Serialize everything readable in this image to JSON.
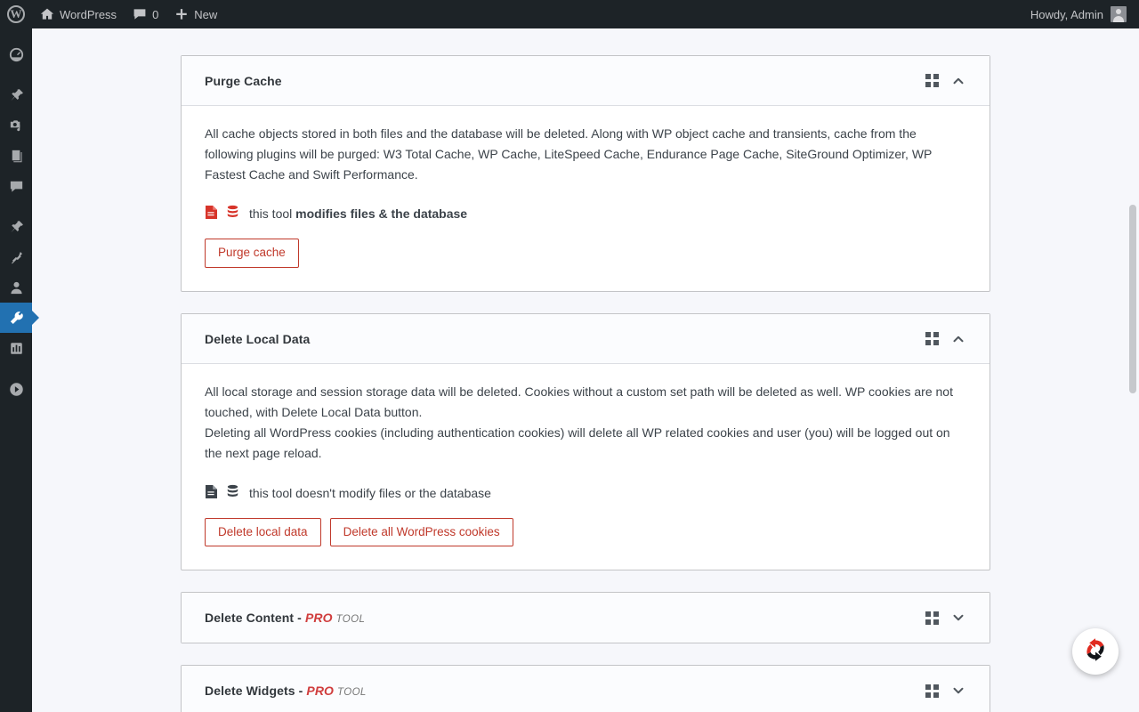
{
  "adminbar": {
    "logo_icon": "wordpress-logo-icon",
    "site_name": "WordPress",
    "site_icon": "home-icon",
    "comments_icon": "comment-bubble-icon",
    "comments_count": "0",
    "new_icon": "plus-icon",
    "new_label": "New",
    "howdy": "Howdy, Admin",
    "avatar_icon": "user-avatar-icon"
  },
  "sidebar": {
    "items": [
      {
        "name": "dashboard",
        "icon": "dashboard-gauge-icon",
        "current": false
      },
      {
        "name": "posts",
        "icon": "pushpin-icon",
        "current": false
      },
      {
        "name": "media",
        "icon": "media-camera-music-icon",
        "current": false
      },
      {
        "name": "pages",
        "icon": "page-document-icon",
        "current": false
      },
      {
        "name": "comments",
        "icon": "comment-bubble-icon",
        "current": false
      },
      {
        "name": "appearance",
        "icon": "paintbrush-icon",
        "current": false
      },
      {
        "name": "plugins",
        "icon": "plug-icon",
        "current": false
      },
      {
        "name": "users",
        "icon": "user-icon",
        "current": false
      },
      {
        "name": "tools",
        "icon": "wrench-icon",
        "current": true
      },
      {
        "name": "settings",
        "icon": "settings-sliders-icon",
        "current": false
      },
      {
        "name": "collapse-menu",
        "icon": "collapse-arrow-icon",
        "current": false
      }
    ]
  },
  "colors": {
    "danger": "#c0392b",
    "pro_red": "#d03d3d",
    "accent_blue": "#2271b1",
    "adminbar_bg": "#1d2327",
    "page_bg": "#f6f7fb"
  },
  "panels": [
    {
      "id": "purge-cache",
      "title": "Purge Cache",
      "open": true,
      "drag_icon": "grid-drag-handle-icon",
      "toggle_icon": "chevron-up-icon",
      "paragraphs": [
        "All cache objects stored in both files and the database will be deleted. Along with WP object cache and transients, cache from the following plugins will be purged: W3 Total Cache, WP Cache, LiteSpeed Cache, Endurance Page Cache, SiteGround Optimizer, WP Fastest Cache and Swift Performance."
      ],
      "note": {
        "file_icon": "file-document-icon",
        "db_icon": "database-stack-icon",
        "danger": true,
        "prefix": "this tool ",
        "strong": "modifies files & the database"
      },
      "buttons": [
        {
          "name": "purge-cache-button",
          "label": "Purge cache"
        }
      ]
    },
    {
      "id": "delete-local-data",
      "title": "Delete Local Data",
      "open": true,
      "drag_icon": "grid-drag-handle-icon",
      "toggle_icon": "chevron-up-icon",
      "paragraphs": [
        "All local storage and session storage data will be deleted. Cookies without a custom set path will be deleted as well. WP cookies are not touched, with Delete Local Data button.",
        "Deleting all WordPress cookies (including authentication cookies) will delete all WP related cookies and user (you) will be logged out on the next page reload."
      ],
      "note": {
        "file_icon": "file-document-icon",
        "db_icon": "database-stack-icon",
        "danger": false,
        "prefix": "this tool doesn't modify files or the database",
        "strong": ""
      },
      "buttons": [
        {
          "name": "delete-local-data-button",
          "label": "Delete local data"
        },
        {
          "name": "delete-all-wordpress-cookies-button",
          "label": "Delete all WordPress cookies"
        }
      ]
    },
    {
      "id": "delete-content",
      "title": "Delete Content - ",
      "pro_label": "PRO",
      "tool_label": "TOOL",
      "open": false,
      "drag_icon": "grid-drag-handle-icon",
      "toggle_icon": "chevron-down-icon",
      "paragraphs": [],
      "buttons": []
    },
    {
      "id": "delete-widgets",
      "title": "Delete Widgets - ",
      "pro_label": "PRO",
      "tool_label": "TOOL",
      "open": false,
      "drag_icon": "grid-drag-handle-icon",
      "toggle_icon": "chevron-down-icon",
      "paragraphs": [],
      "buttons": []
    }
  ],
  "fab": {
    "name": "refresh-sync-button",
    "icon": "circular-sync-arrows-icon"
  },
  "scrollbar": {
    "name": "page-scrollbar"
  }
}
